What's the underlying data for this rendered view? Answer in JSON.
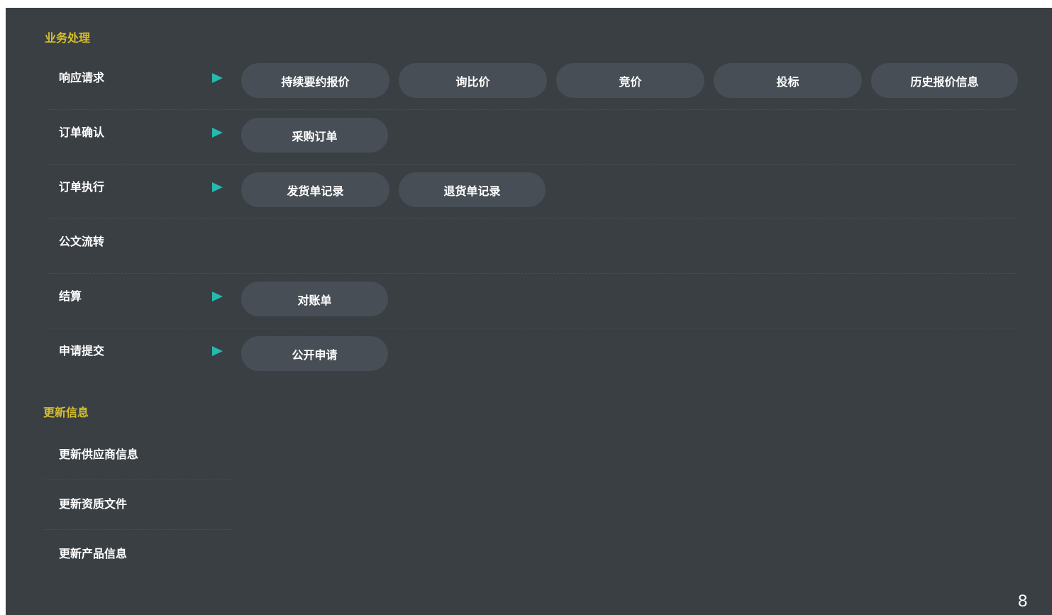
{
  "business": {
    "title": "业务处理",
    "rows": [
      {
        "label": "响应请求",
        "buttons": [
          "持续要约报价",
          "询比价",
          "竞价",
          "投标",
          "历史报价信息"
        ]
      },
      {
        "label": "订单确认",
        "buttons": [
          "采购订单"
        ]
      },
      {
        "label": "订单执行",
        "buttons": [
          "发货单记录",
          "退货单记录"
        ]
      },
      {
        "label": "公文流转",
        "buttons": []
      },
      {
        "label": "结算",
        "buttons": [
          "对账单"
        ]
      },
      {
        "label": "申请提交",
        "buttons": [
          "公开申请"
        ]
      }
    ]
  },
  "updates": {
    "title": "更新信息",
    "items": [
      "更新供应商信息",
      "更新资质文件",
      "更新产品信息"
    ]
  },
  "page_number": "8",
  "colors": {
    "panel_bg": "#3a3f44",
    "button_bg": "#474e55",
    "section_title": "#d6bf2b",
    "arrow": "#27b9b0"
  }
}
